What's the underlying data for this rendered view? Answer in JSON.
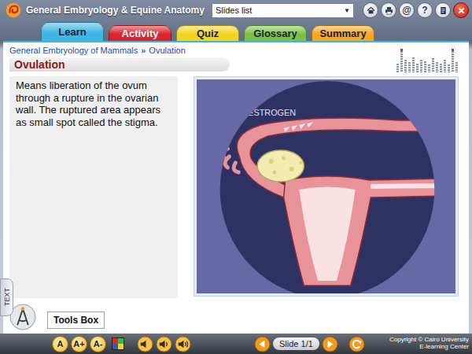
{
  "window": {
    "title": "General Embryology & Equine Anatomy"
  },
  "slides_dropdown": {
    "value": "Slides list",
    "arrow": "▼"
  },
  "top_buttons": [
    {
      "kind": "home"
    },
    {
      "kind": "print"
    },
    {
      "kind": "text",
      "label": "@"
    },
    {
      "kind": "text",
      "label": "?"
    },
    {
      "kind": "notes"
    },
    {
      "kind": "close"
    }
  ],
  "tabs": [
    {
      "label": "Learn",
      "selected": true,
      "color": "#3fb6e4"
    },
    {
      "label": "Activity",
      "selected": false,
      "color": "#d9252b"
    },
    {
      "label": "Quiz",
      "selected": false,
      "color": "#f2d41e"
    },
    {
      "label": "Glossary",
      "selected": false,
      "color": "#7cc242"
    },
    {
      "label": "Summary",
      "selected": false,
      "color": "#f6a81f"
    }
  ],
  "breadcrumb": {
    "items": [
      "General Embryology of Mammals",
      "Ovulation"
    ],
    "separator": "»"
  },
  "slide": {
    "title": "Ovulation",
    "text": "Means liberation of the ovum through a rupture in the ovarian wall. The ruptured area appears as small spot called the stigma."
  },
  "figure": {
    "label": "ESTROGEN"
  },
  "equalizer": [
    {
      "level": 0.35,
      "peak": false
    },
    {
      "level": 0.95,
      "peak": true
    },
    {
      "level": 0.5,
      "peak": false
    },
    {
      "level": 0.4,
      "peak": false
    },
    {
      "level": 0.6,
      "peak": false
    },
    {
      "level": 0.35,
      "peak": false
    },
    {
      "level": 0.5,
      "peak": false
    },
    {
      "level": 0.45,
      "peak": false
    },
    {
      "level": 0.3,
      "peak": false
    },
    {
      "level": 0.55,
      "peak": false
    },
    {
      "level": 0.4,
      "peak": false
    },
    {
      "level": 0.35,
      "peak": false
    },
    {
      "level": 0.5,
      "peak": false
    },
    {
      "level": 0.3,
      "peak": false
    },
    {
      "level": 0.95,
      "peak": true
    },
    {
      "level": 0.4,
      "peak": false
    }
  ],
  "side_tab": {
    "label": "TEXT"
  },
  "tools_box": {
    "label": "Tools Box"
  },
  "font_buttons": [
    "A",
    "A+",
    "A-"
  ],
  "navigation": {
    "slide_label": "Slide 1/1"
  },
  "copyright": [
    "Copyright © Cairo University",
    "E-learning Center"
  ]
}
